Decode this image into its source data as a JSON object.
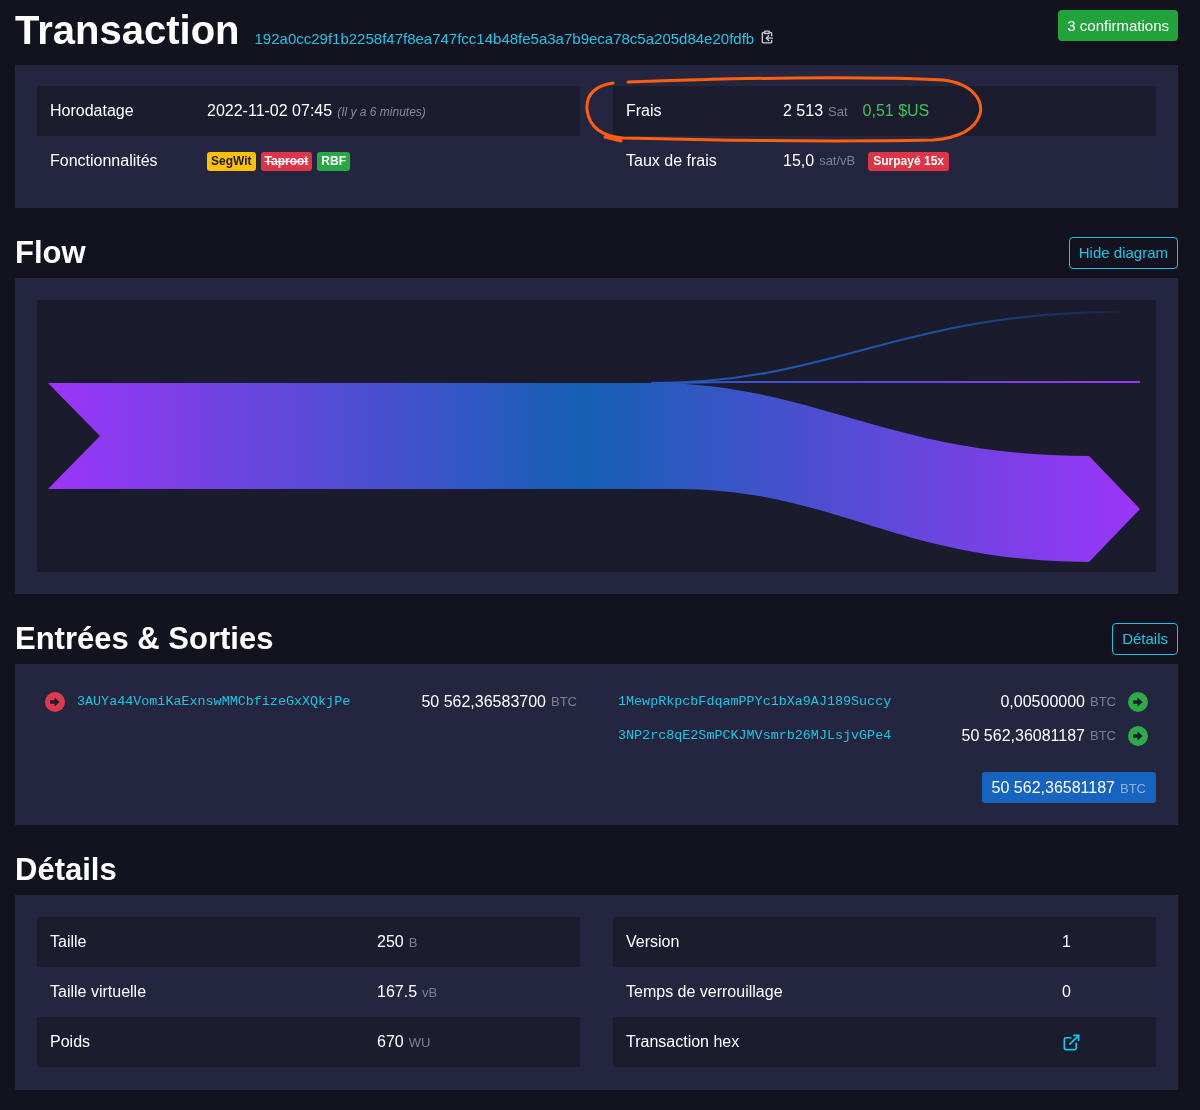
{
  "header": {
    "title": "Transaction",
    "txid": "192a0cc29f1b2258f47f8ea747fcc14b48fe5a3a7b9eca78c5a205d84e20fdfb",
    "confirmations": "3 confirmations"
  },
  "summary": {
    "left": [
      {
        "label": "Horodatage",
        "kind": "timestamp",
        "value": "2022-11-02 07:45",
        "note": "(Il y a 6 minutes)"
      },
      {
        "label": "Fonctionnalités",
        "kind": "badges",
        "badges": [
          {
            "label": "SegWit",
            "color": "#ffc107",
            "struck": false
          },
          {
            "label": "Taproot",
            "color": "#dc3545",
            "struck": true
          },
          {
            "label": "RBF",
            "color": "#28a745",
            "struck": false
          }
        ]
      }
    ],
    "right": [
      {
        "label": "Frais",
        "kind": "fee",
        "value": "2 513",
        "unit": "Sat",
        "fiat": "0,51 $US",
        "highlighted": true
      },
      {
        "label": "Taux de frais",
        "kind": "rate",
        "value": "15,0",
        "unit": "sat/vB",
        "badge": "Surpayé 15x"
      }
    ]
  },
  "flow": {
    "title": "Flow",
    "toggle": "Hide diagram"
  },
  "io": {
    "title": "Entrées & Sorties",
    "toggle": "Détails",
    "inputs": [
      {
        "address": "3AUYa44VomiKaExnswMMCbfizeGxXQkjPe",
        "amount": "50 562,36583700",
        "unit": "BTC"
      }
    ],
    "outputs": [
      {
        "address": "1MewpRkpcbFdqamPPYc1bXa9AJ189Succy",
        "amount": "0,00500000",
        "unit": "BTC"
      },
      {
        "address": "3NP2rc8qE2SmPCKJMVsmrb26MJLsjvGPe4",
        "amount": "50 562,36081187",
        "unit": "BTC"
      }
    ],
    "total": {
      "amount": "50 562,36581187",
      "unit": "BTC"
    }
  },
  "details": {
    "title": "Détails",
    "left": [
      {
        "label": "Taille",
        "kind": "value",
        "value": "250",
        "unit": "B"
      },
      {
        "label": "Taille virtuelle",
        "kind": "value",
        "value": "167.5",
        "unit": "vB"
      },
      {
        "label": "Poids",
        "kind": "value",
        "value": "670",
        "unit": "WU"
      }
    ],
    "right": [
      {
        "label": "Version",
        "kind": "value",
        "value": "1"
      },
      {
        "label": "Temps de verrouillage",
        "kind": "value",
        "value": "0"
      },
      {
        "label": "Transaction hex",
        "kind": "link"
      }
    ]
  }
}
